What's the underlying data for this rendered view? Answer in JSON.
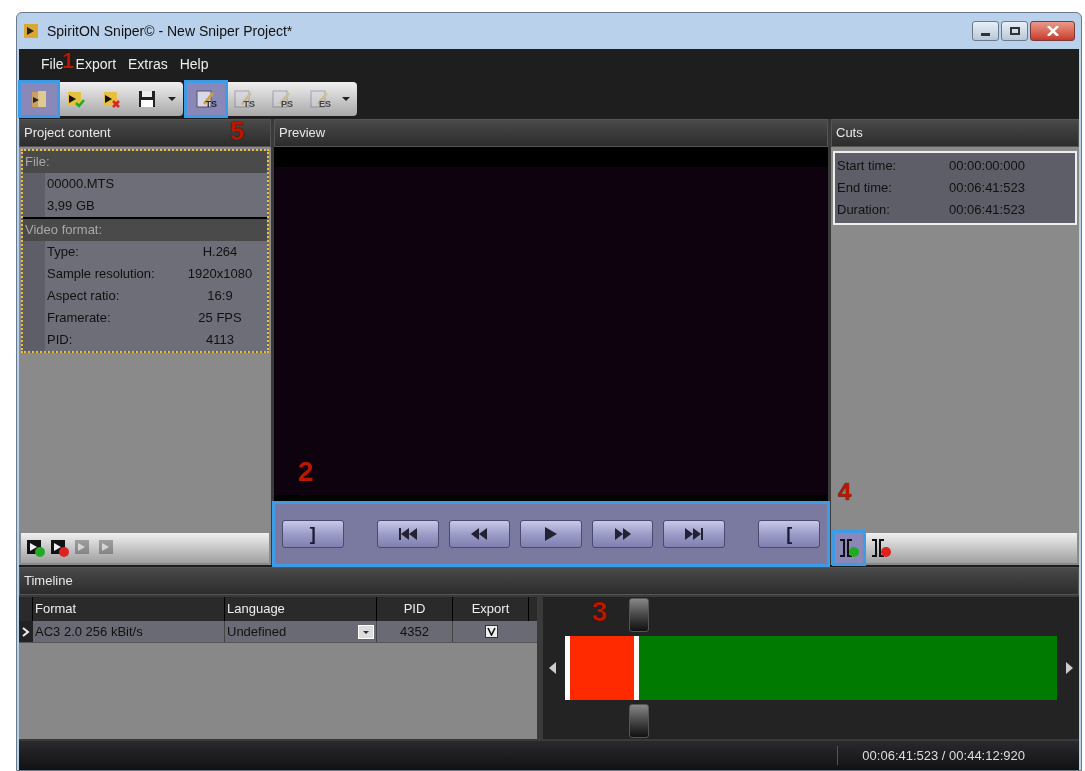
{
  "window": {
    "title": "SpiritON Sniper© - New Sniper Project*"
  },
  "menu": [
    "File",
    "Export",
    "Extras",
    "Help"
  ],
  "toolbar": [
    {
      "kind": "open",
      "disabled": false,
      "highlighted": true
    },
    {
      "kind": "accept",
      "disabled": false,
      "highlighted": false
    },
    {
      "kind": "reject",
      "disabled": false,
      "highlighted": false
    },
    {
      "kind": "save",
      "disabled": false,
      "highlighted": false
    },
    {
      "kind": "edit",
      "label": "TS",
      "disabled": false,
      "highlighted": true
    },
    {
      "kind": "edit",
      "label": "TS",
      "disabled": true,
      "highlighted": false
    },
    {
      "kind": "edit",
      "label": "PS",
      "disabled": true,
      "highlighted": false
    },
    {
      "kind": "edit",
      "label": "ES",
      "disabled": true,
      "highlighted": false
    }
  ],
  "project_content": {
    "title": "Project content",
    "groups": [
      {
        "heading": "File:",
        "rows": [
          {
            "label": "00000.MTS"
          },
          {
            "label": "3,99 GB"
          }
        ]
      },
      {
        "heading": "Video format:",
        "rows": [
          {
            "label": "Type:",
            "value": "H.264"
          },
          {
            "label": "Sample resolution:",
            "value": "1920x1080"
          },
          {
            "label": "Aspect ratio:",
            "value": "16:9"
          },
          {
            "label": "Framerate:",
            "value": "25 FPS"
          },
          {
            "label": "PID:",
            "value": "4113"
          }
        ]
      }
    ],
    "tools": [
      {
        "kind": "add",
        "disabled": false
      },
      {
        "kind": "remove",
        "disabled": false
      },
      {
        "kind": "up",
        "disabled": true
      },
      {
        "kind": "down",
        "disabled": true
      }
    ]
  },
  "preview": {
    "title": "Preview",
    "highlighted": true,
    "controls": [
      {
        "kind": "text",
        "label": "]"
      },
      {
        "kind": "skip-back"
      },
      {
        "kind": "rewind"
      },
      {
        "kind": "play"
      },
      {
        "kind": "forward"
      },
      {
        "kind": "skip-forward"
      },
      {
        "kind": "text",
        "label": "["
      }
    ]
  },
  "cuts": {
    "title": "Cuts",
    "rows": [
      {
        "label": "Start time:",
        "value": "00:00:00:000"
      },
      {
        "label": "End time:",
        "value": "00:06:41:523"
      },
      {
        "label": "Duration:",
        "value": "00:06:41:523"
      }
    ],
    "tools": [
      {
        "kind": "add-cut",
        "highlighted": true
      },
      {
        "kind": "remove-cut",
        "highlighted": false
      }
    ]
  },
  "timeline": {
    "title": "Timeline",
    "columns": [
      "Format",
      "Language",
      "PID",
      "Export"
    ],
    "rows": [
      {
        "format": "AC3 2.0 256 kBit/s",
        "language": "Undefined",
        "pid": "4352",
        "export": true,
        "selected": true
      }
    ],
    "cut": {
      "level": 0.151
    }
  },
  "status_bar": {
    "position": "00:06:41:523 / 00:44:12:920"
  },
  "callouts": [
    "1",
    "2",
    "3",
    "4",
    "5"
  ]
}
